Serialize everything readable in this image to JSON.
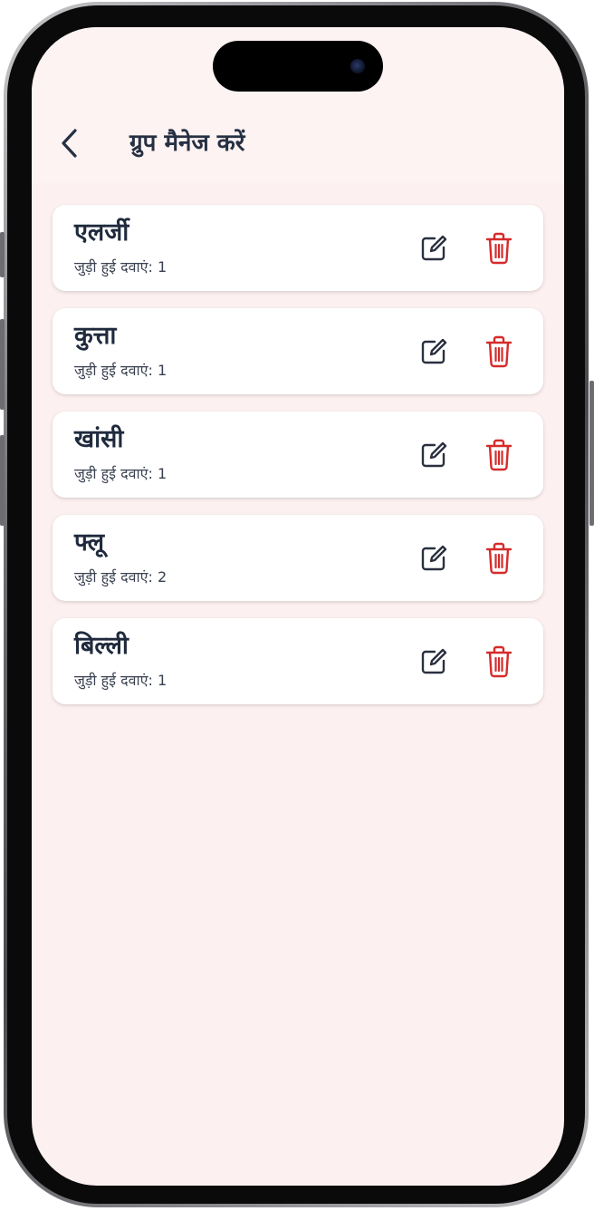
{
  "header": {
    "title": "ग्रुप मैनेज करें",
    "back_icon": "chevron-left-icon"
  },
  "colors": {
    "background": "#fdf0f0",
    "header_background": "#fdf3f3",
    "card_background": "#ffffff",
    "title_text": "#263043",
    "edit_icon": "#2a3040",
    "delete_icon": "#d62b2b"
  },
  "groups": [
    {
      "name": "एलर्जी",
      "linked_label": "जुड़ी हुई दवाएं: 1"
    },
    {
      "name": "कुत्ता",
      "linked_label": "जुड़ी हुई दवाएं: 1"
    },
    {
      "name": "खांसी",
      "linked_label": "जुड़ी हुई दवाएं: 1"
    },
    {
      "name": "फ्लू",
      "linked_label": "जुड़ी हुई दवाएं: 2"
    },
    {
      "name": "बिल्ली",
      "linked_label": "जुड़ी हुई दवाएं: 1"
    }
  ],
  "icons": {
    "edit": "edit-icon",
    "delete": "trash-icon"
  }
}
